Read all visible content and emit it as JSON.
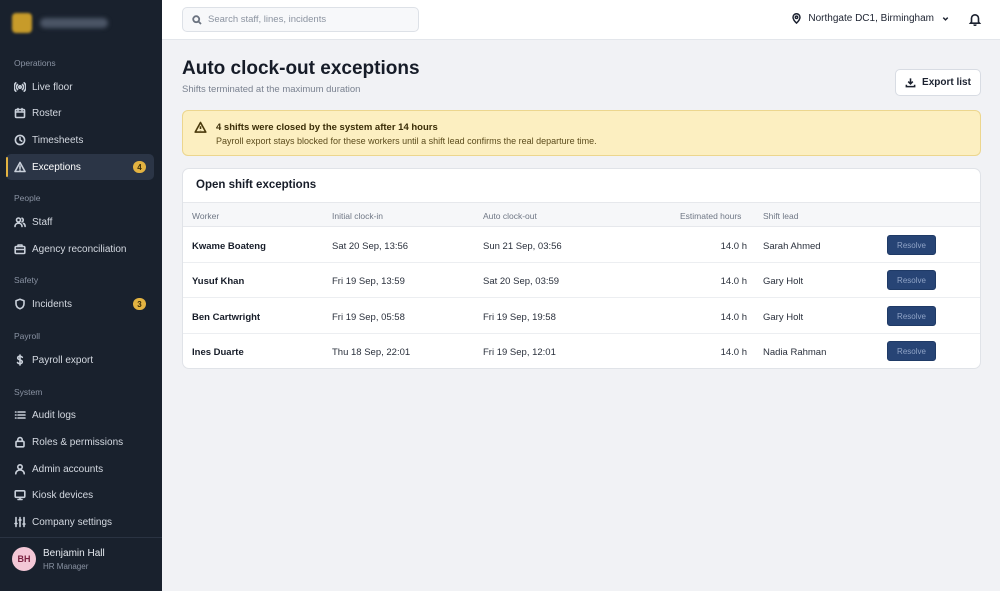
{
  "search": {
    "placeholder": "Search staff, lines, incidents"
  },
  "topbar": {
    "location": "Northgate DC1, Birmingham"
  },
  "sidebar": {
    "sections": {
      "operations": "Operations",
      "people": "People",
      "safety": "Safety",
      "payroll": "Payroll",
      "system": "System"
    },
    "items": {
      "live_floor": "Live floor",
      "roster": "Roster",
      "timesheets": "Timesheets",
      "exceptions": "Exceptions",
      "exceptions_badge": "4",
      "staff": "Staff",
      "agency": "Agency reconciliation",
      "incidents": "Incidents",
      "incidents_badge": "3",
      "payroll_export": "Payroll export",
      "audit_logs": "Audit logs",
      "roles": "Roles & permissions",
      "admin_accounts": "Admin accounts",
      "kiosk_devices": "Kiosk devices",
      "company_settings": "Company settings"
    },
    "user": {
      "initials": "BH",
      "name": "Benjamin Hall",
      "role": "HR Manager"
    }
  },
  "page": {
    "title": "Auto clock-out exceptions",
    "subtitle": "Shifts terminated at the maximum duration",
    "export_label": "Export list"
  },
  "alert": {
    "title": "4 shifts were closed by the system after 14 hours",
    "text": "Payroll export stays blocked for these workers until a shift lead confirms the real departure time."
  },
  "table": {
    "title": "Open shift exceptions",
    "headers": {
      "worker": "Worker",
      "clock_in": "Initial clock-in",
      "clock_out": "Auto clock-out",
      "hours": "Estimated hours",
      "lead": "Shift lead"
    },
    "rows": [
      {
        "worker": "Kwame Boateng",
        "clock_in": "Sat 20 Sep, 13:56",
        "clock_out": "Sun 21 Sep, 03:56",
        "hours": "14.0 h",
        "lead": "Sarah Ahmed",
        "action": "Resolve"
      },
      {
        "worker": "Yusuf Khan",
        "clock_in": "Fri 19 Sep, 13:59",
        "clock_out": "Sat 20 Sep, 03:59",
        "hours": "14.0 h",
        "lead": "Gary Holt",
        "action": "Resolve"
      },
      {
        "worker": "Ben Cartwright",
        "clock_in": "Fri 19 Sep, 05:58",
        "clock_out": "Fri 19 Sep, 19:58",
        "hours": "14.0 h",
        "lead": "Gary Holt",
        "action": "Resolve"
      },
      {
        "worker": "Ines Duarte",
        "clock_in": "Thu 18 Sep, 22:01",
        "clock_out": "Fri 19 Sep, 12:01",
        "hours": "14.0 h",
        "lead": "Nadia Rahman",
        "action": "Resolve"
      }
    ]
  },
  "colors": {
    "sidebar_bg": "#19212d",
    "accent": "#e3b341",
    "alert_bg": "#fcefc1",
    "resolve_bg": "#274475"
  }
}
